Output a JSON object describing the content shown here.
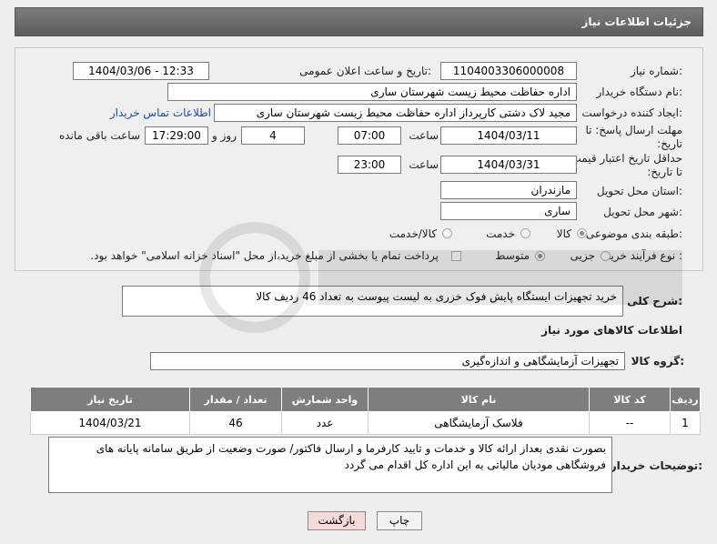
{
  "header": {
    "title": "جزئیات اطلاعات نیاز"
  },
  "form": {
    "need_number_label": "شماره نیاز:",
    "need_number": "1104003306000008",
    "announce_label": "تاریخ و ساعت اعلان عمومی:",
    "announce_value": "1404/03/06 - 12:33",
    "buyer_org_label": "نام دستگاه خریدار:",
    "buyer_org": "اداره حفاظت محیط زیست شهرستان ساری",
    "creator_label": "ایجاد کننده درخواست:",
    "creator": "مجید لاک دشتی کارپرداز اداره حفاظت محیط زیست شهرستان ساری",
    "contact_link": "اطلاعات تماس خریدار",
    "deadline_label": "مهلت ارسال پاسخ: تا تاریخ:",
    "deadline_date": "1404/03/11",
    "time_label": "ساعت",
    "deadline_time": "07:00",
    "days_value": "4",
    "days_label": "روز و",
    "remaining_time": "17:29:00",
    "remaining_label": "ساعت باقی مانده",
    "validity_label": "حداقل تاریخ اعتبار قیمت: تا تاریخ:",
    "validity_date": "1404/03/31",
    "validity_time": "23:00",
    "province_label": "استان محل تحویل:",
    "province": "مازندران",
    "city_label": "شهر محل تحویل:",
    "city": "ساری",
    "category_label": "طبقه بندی موضوعی:",
    "category_options": [
      "کالا",
      "خدمت",
      "کالا/خدمت"
    ],
    "process_label": "نوع فرآیند خرید :",
    "process_options": [
      "جزیی",
      "متوسط"
    ],
    "payment_note": "پرداخت تمام یا بخشی از مبلغ خرید،از محل \"اسناد خزانه اسلامی\" خواهد بود."
  },
  "description": {
    "label": "شرح کلی نیاز:",
    "text": "خرید تجهیزات ایستگاه پایش فوک خزری به لیست پیوست به تعداد 46 ردیف کالا"
  },
  "goods": {
    "section_title": "اطلاعات کالاهای مورد نیاز",
    "group_label": "گروه کالا:",
    "group_value": "تجهیزات آزمایشگاهی و اندازه‌گیری",
    "columns": [
      "ردیف",
      "کد کالا",
      "نام کالا",
      "واحد شمارش",
      "تعداد / مقدار",
      "تاریخ نیاز"
    ],
    "rows": [
      {
        "row": "1",
        "code": "--",
        "name": "فلاسک آزمایشگاهی",
        "unit": "عدد",
        "qty": "46",
        "date": "1404/03/21"
      }
    ]
  },
  "buyer_notes": {
    "label": "توضیحات خریدار:",
    "text": "بصورت نقدی بعداز ارائه کالا و خدمات  و تایید کارفرما و ارسال فاکتور/ صورت وضعیت از طریق سامانه پایانه های فروشگاهی مودیان مالیاتی به این اداره کل اقدام می گردد"
  },
  "buttons": {
    "print": "چاپ",
    "back": "بازگشت"
  },
  "colors": {
    "header_bg": "#6e6e6e",
    "table_header_bg": "#7e7e7e",
    "link": "#1a4fa0",
    "back_button_bg": "#f6d9d9"
  }
}
